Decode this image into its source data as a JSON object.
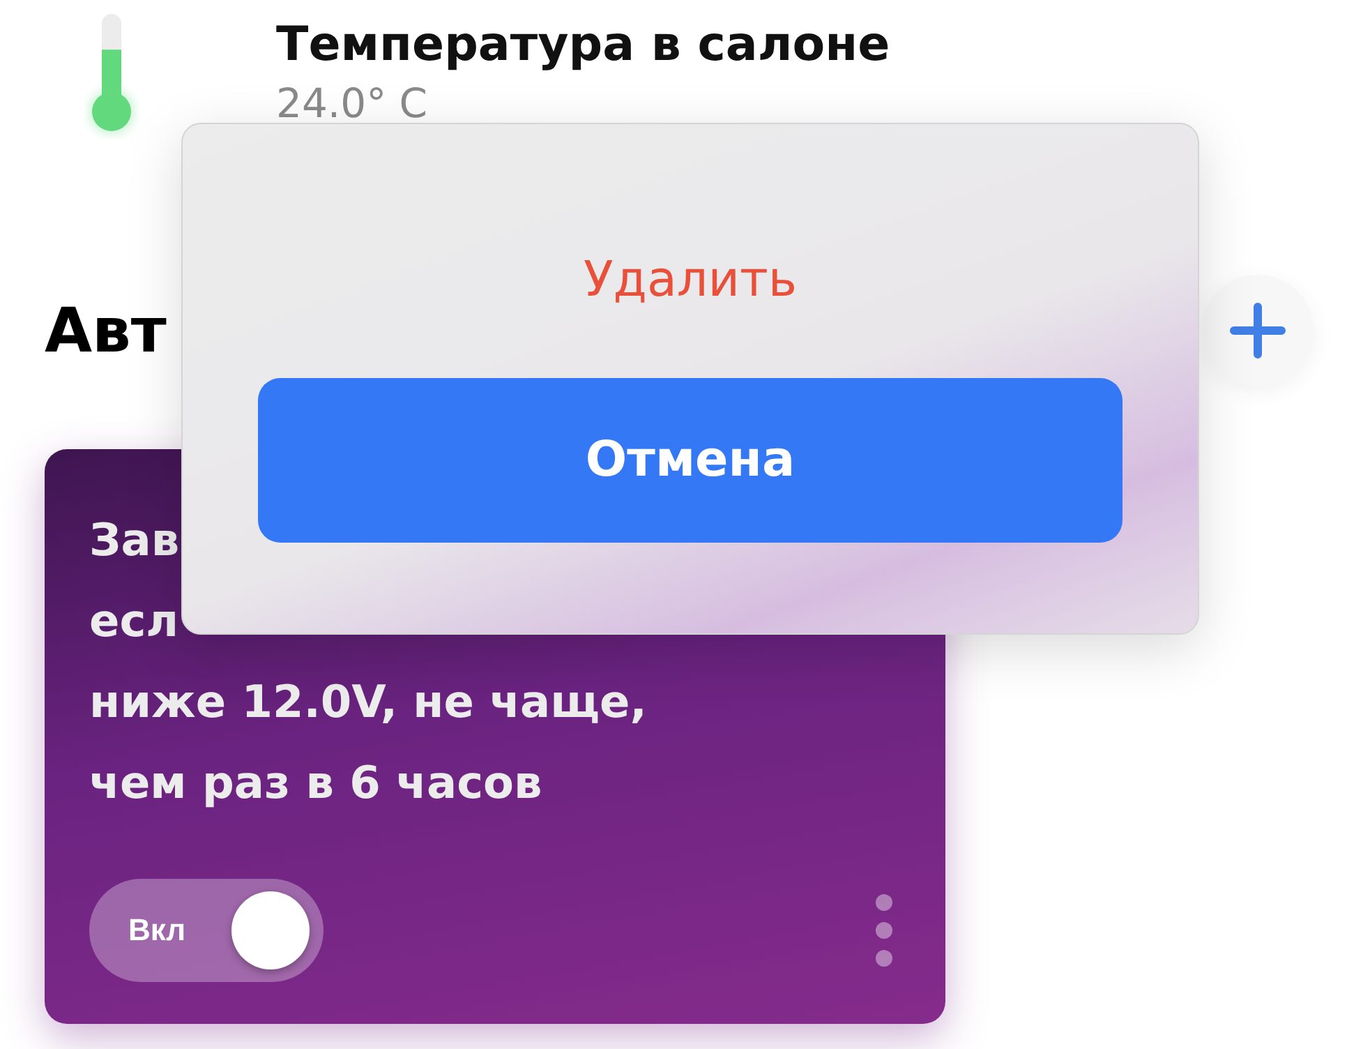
{
  "sensor": {
    "title": "Температура в салоне",
    "reading": "24.0° C"
  },
  "section": {
    "title": "Авт"
  },
  "automation": {
    "lines": [
      "Зав",
      "есл",
      "ниже 12.0V, не чаще,",
      "чем раз в 6 часов"
    ],
    "toggle": {
      "label": "Вкл",
      "on": true
    }
  },
  "dialog": {
    "destructive": "Удалить",
    "cancel": "Отмена"
  }
}
